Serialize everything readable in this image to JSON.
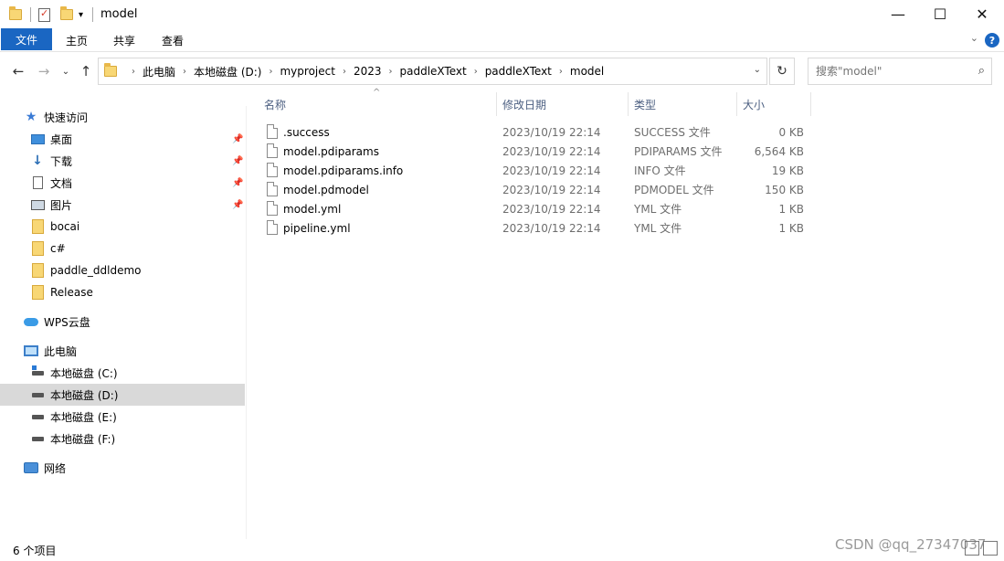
{
  "window": {
    "title": "model",
    "minimize": "—",
    "maximize": "☐",
    "close": "✕"
  },
  "ribbon": {
    "tabs": [
      "文件",
      "主页",
      "共享",
      "查看"
    ],
    "help": "?"
  },
  "nav": {
    "breadcrumbs": [
      "此电脑",
      "本地磁盘 (D:)",
      "myproject",
      "2023",
      "paddleXText",
      "paddleXText",
      "model"
    ],
    "search_placeholder": "搜索\"model\""
  },
  "sidebar": {
    "quick_access": "快速访问",
    "pinned": [
      "桌面",
      "下载",
      "文档",
      "图片"
    ],
    "folders": [
      "bocai",
      "c#",
      "paddle_ddldemo",
      "Release"
    ],
    "wps": "WPS云盘",
    "this_pc": "此电脑",
    "drives": [
      "本地磁盘 (C:)",
      "本地磁盘 (D:)",
      "本地磁盘 (E:)",
      "本地磁盘 (F:)"
    ],
    "network": "网络"
  },
  "columns": {
    "name": "名称",
    "date": "修改日期",
    "type": "类型",
    "size": "大小"
  },
  "files": [
    {
      "name": ".success",
      "date": "2023/10/19 22:14",
      "type": "SUCCESS 文件",
      "size": "0 KB"
    },
    {
      "name": "model.pdiparams",
      "date": "2023/10/19 22:14",
      "type": "PDIPARAMS 文件",
      "size": "6,564 KB"
    },
    {
      "name": "model.pdiparams.info",
      "date": "2023/10/19 22:14",
      "type": "INFO 文件",
      "size": "19 KB"
    },
    {
      "name": "model.pdmodel",
      "date": "2023/10/19 22:14",
      "type": "PDMODEL 文件",
      "size": "150 KB"
    },
    {
      "name": "model.yml",
      "date": "2023/10/19 22:14",
      "type": "YML 文件",
      "size": "1 KB"
    },
    {
      "name": "pipeline.yml",
      "date": "2023/10/19 22:14",
      "type": "YML 文件",
      "size": "1 KB"
    }
  ],
  "status": {
    "count": "6 个项目",
    "watermark": "CSDN @qq_27347037"
  }
}
